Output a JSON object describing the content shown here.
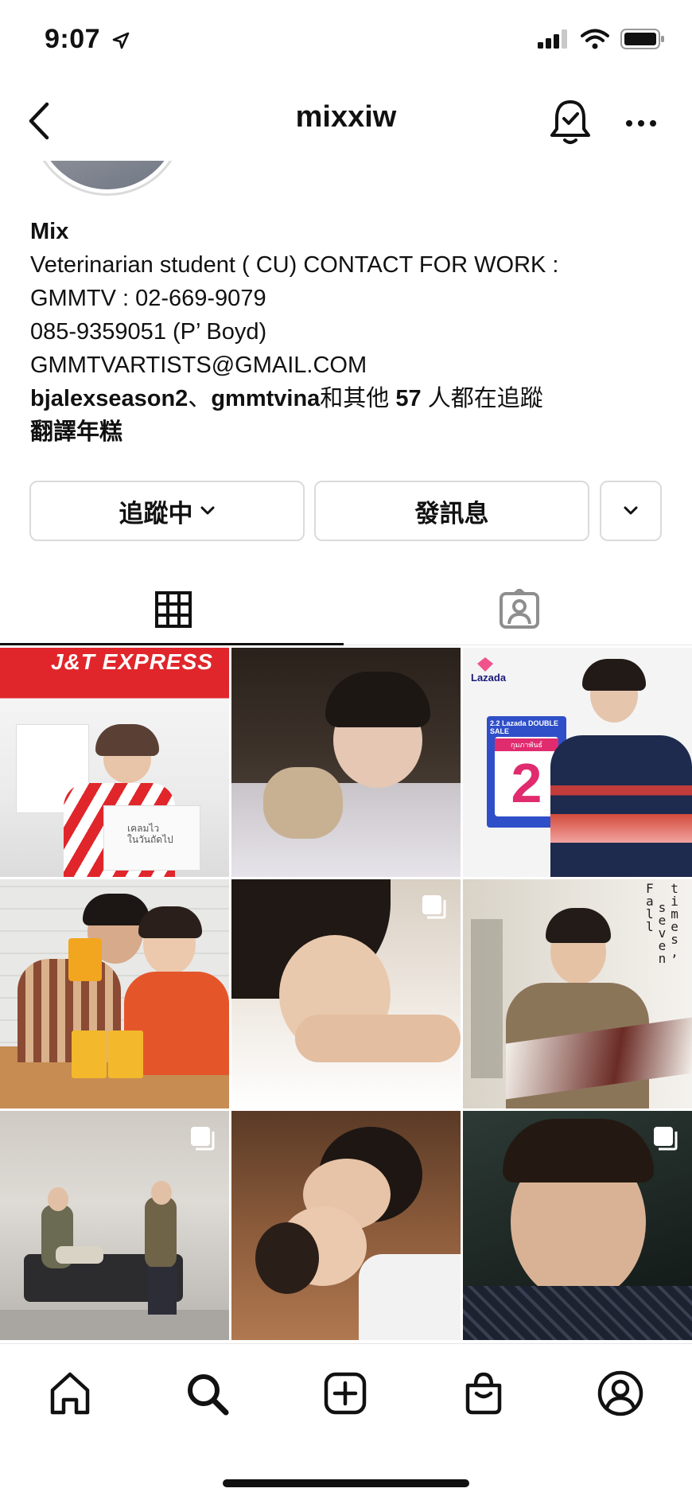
{
  "status": {
    "time": "9:07"
  },
  "nav": {
    "title": "mixxiw"
  },
  "profile": {
    "name": "Mix",
    "bio": [
      "Veterinarian student ( CU) CONTACT FOR WORK :",
      "GMMTV : 02-669-9079",
      "085-9359051 (P’ Boyd)",
      "GMMTVARTISTS@GMAIL.COM"
    ],
    "followed_by_user1": "bjalexseason2",
    "followed_by_sep": "、",
    "followed_by_user2": "gmmtvina",
    "followed_by_mid": "和其他",
    "followed_by_count": "57",
    "followed_by_suffix": "人都在追蹤",
    "translate": "翻譯年糕"
  },
  "actions": {
    "following_label": "追蹤中",
    "message_label": "發訊息"
  },
  "posts": {
    "items": [
      {
        "label": "J&T EXPRESS",
        "sub": "เคลมไว\nในวันถัดไป"
      },
      {
        "label": ""
      },
      {
        "label": "Lazada",
        "sub": "2.2 Lazada DOUBLE SALE",
        "num": "2",
        "thai": "กุมภาพันธ์"
      },
      {
        "label": ""
      },
      {
        "label": ""
      },
      {
        "label": ""
      },
      {
        "label": ""
      },
      {
        "label": ""
      },
      {
        "label": ""
      }
    ]
  },
  "art_text": {
    "poster": [
      "F",
      "a",
      "l",
      "l",
      "t",
      "i",
      "m",
      "e",
      "s",
      ",",
      " ",
      "s",
      "e",
      "v",
      "e",
      "n"
    ]
  },
  "colors": {
    "jt_red": "#e0262b",
    "lazada_blue": "#2f4fc9",
    "divider": "#dbdbdb"
  }
}
